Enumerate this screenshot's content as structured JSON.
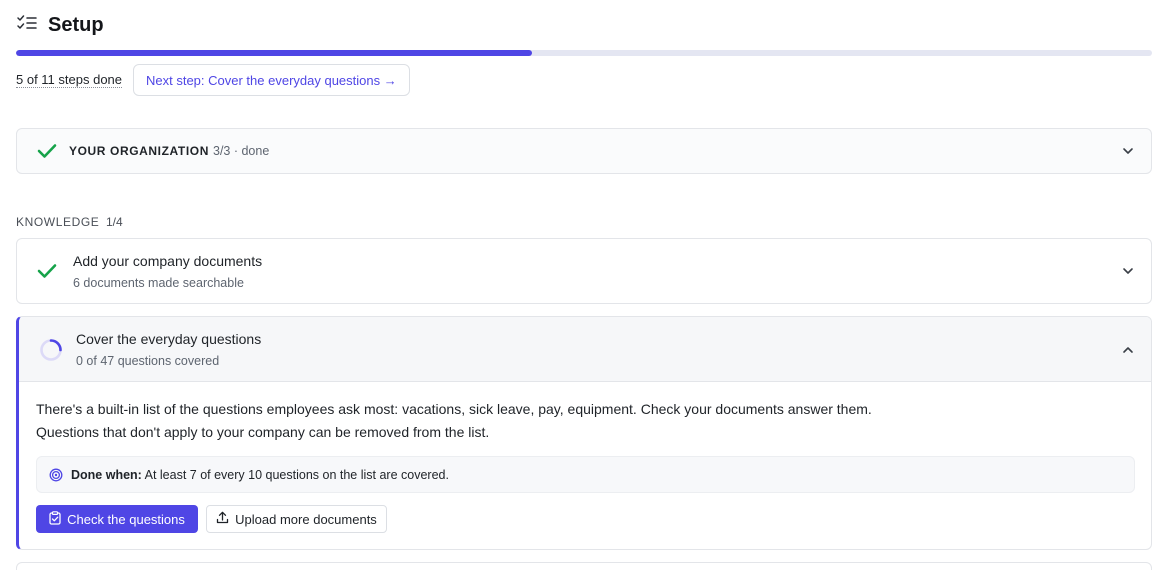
{
  "header": {
    "title": "Setup",
    "icon": "checklist-icon"
  },
  "progress": {
    "completed": 5,
    "total": 11,
    "steps_done_text": "5 of 11 steps done",
    "next_step_label": "Next step: Cover the everyday questions →"
  },
  "organization": {
    "label": "YOUR ORGANIZATION",
    "status": "3/3 · done"
  },
  "knowledge": {
    "label": "KNOWLEDGE",
    "count": "1/4",
    "items": [
      {
        "title": "Add your company documents",
        "subtitle": "6 documents made searchable",
        "state": "done"
      },
      {
        "title": "Cover the everyday questions",
        "subtitle": "0 of 47 questions covered",
        "state": "in-progress",
        "description_1": "There's a built-in list of the questions employees ask most: vacations, sick leave, pay, equipment. Check your documents answer them.",
        "description_2": "Questions that don't apply to your company can be removed from the list.",
        "done_when_label": "Done when:",
        "done_when_text": " At least 7 of every 10 questions on the list are covered.",
        "primary_button": "Check the questions",
        "secondary_button": "Upload more documents"
      }
    ]
  },
  "colors": {
    "accent": "#4f46e5",
    "success": "#16a34a"
  }
}
